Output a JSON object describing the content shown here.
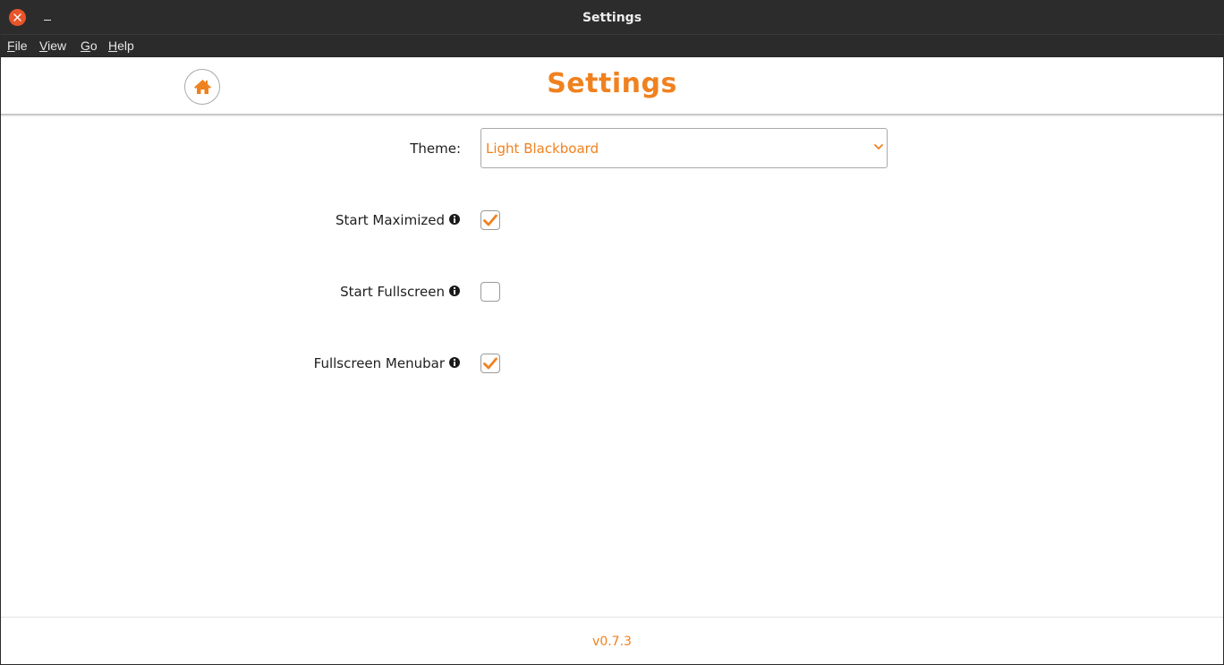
{
  "window": {
    "title": "Settings"
  },
  "menubar": {
    "items": [
      {
        "label": "File",
        "mnemonic": "F",
        "rest": "ile"
      },
      {
        "label": "View",
        "mnemonic": "V",
        "rest": "iew"
      },
      {
        "label": "Go",
        "mnemonic": "G",
        "rest": "o"
      },
      {
        "label": "Help",
        "mnemonic": "H",
        "rest": "elp"
      }
    ]
  },
  "header": {
    "title": "Settings",
    "home_icon": "home-icon"
  },
  "settings": {
    "theme": {
      "label": "Theme:",
      "selected": "Light Blackboard"
    },
    "start_maximized": {
      "label": "Start Maximized",
      "checked": true
    },
    "start_fullscreen": {
      "label": "Start Fullscreen",
      "checked": false
    },
    "fullscreen_menubar": {
      "label": "Fullscreen Menubar",
      "checked": true
    }
  },
  "footer": {
    "version": "v0.7.3"
  },
  "colors": {
    "accent": "#f0811f",
    "titlebar": "#2c2c2c",
    "close": "#e9542a"
  }
}
